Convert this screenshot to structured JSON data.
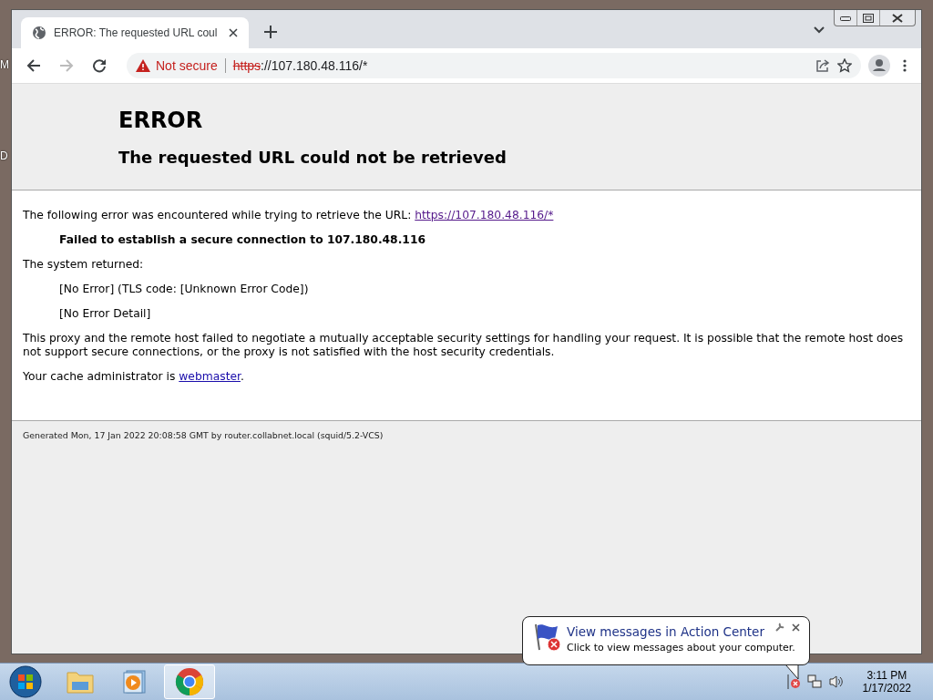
{
  "desktop": {
    "labels": [
      "M",
      "D"
    ]
  },
  "browser": {
    "tabs": [
      {
        "title": "ERROR: The requested URL coul",
        "selected": true
      }
    ],
    "address": {
      "security": "Not secure",
      "scheme": "https",
      "rest": "://107.180.48.116/*"
    }
  },
  "page": {
    "title": "ERROR",
    "subtitle": "The requested URL could not be retrieved",
    "intro": "The following error was encountered while trying to retrieve the URL: ",
    "intro_link": "https://107.180.48.116/*",
    "failure": "Failed to establish a secure connection to 107.180.48.116",
    "system_label": "The system returned:",
    "system_lines": [
      "[No Error] (TLS code: [Unknown Error Code])",
      "[No Error Detail]"
    ],
    "explanation": "This proxy and the remote host failed to negotiate a mutually acceptable security settings for handling your request. It is possible that the remote host does not support secure connections, or the proxy is not satisfied with the host security credentials.",
    "admin": "Your cache administrator is ",
    "admin_link": "webmaster",
    "admin_end": ".",
    "footer": "Generated Mon, 17 Jan 2022 20:08:58 GMT by router.collabnet.local (squid/5.2-VCS)"
  },
  "taskbar": {
    "apps": [
      {
        "kind": "folder",
        "selected": false
      },
      {
        "kind": "media",
        "selected": false
      },
      {
        "kind": "chrome",
        "selected": true
      }
    ],
    "time": "3:11 PM",
    "date": "1/17/2022"
  },
  "balloon": {
    "title": "View messages in Action Center",
    "body": "Click to view messages about your computer."
  }
}
